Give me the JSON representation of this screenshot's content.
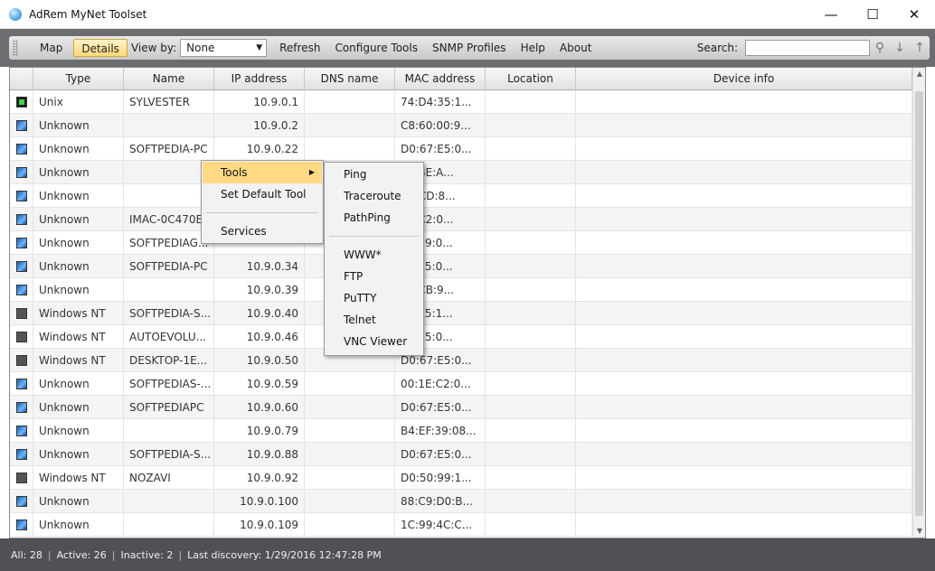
{
  "window": {
    "title": "AdRem MyNet Toolset"
  },
  "toolbar": {
    "map": "Map",
    "details": "Details",
    "view_by_label": "View by:",
    "view_by_value": "None",
    "refresh": "Refresh",
    "configure_tools": "Configure Tools",
    "snmp_profiles": "SNMP Profiles",
    "help": "Help",
    "about": "About",
    "search_label": "Search:",
    "search_value": ""
  },
  "columns": {
    "type": "Type",
    "name": "Name",
    "ip": "IP address",
    "dns": "DNS name",
    "mac": "MAC address",
    "location": "Location",
    "info": "Device info"
  },
  "rows": [
    {
      "icon": "unix-icon",
      "type": "Unix",
      "name": "SYLVESTER",
      "ip": "10.9.0.1",
      "mac": "74:D4:35:1..."
    },
    {
      "icon": "unknown-device-icon",
      "type": "Unknown",
      "name": "",
      "ip": "10.9.0.2",
      "mac": "C8:60:00:9..."
    },
    {
      "icon": "unknown-device-icon",
      "type": "Unknown",
      "name": "SOFTPEDIA-PC",
      "ip": "10.9.0.22",
      "mac": "D0:67:E5:0..."
    },
    {
      "icon": "unknown-device-icon",
      "type": "Unknown",
      "name": "",
      "ip": "",
      "mac": "22:BE:A..."
    },
    {
      "icon": "unknown-device-icon",
      "type": "Unknown",
      "name": "",
      "ip": "",
      "mac": "EB:CD:8..."
    },
    {
      "icon": "unknown-device-icon",
      "type": "Unknown",
      "name": "IMAC-0C470E",
      "ip": "",
      "mac": "1E:C2:0..."
    },
    {
      "icon": "unknown-device-icon",
      "type": "Unknown",
      "name": "SOFTPEDIAG...",
      "ip": "",
      "mac": "50:99:0..."
    },
    {
      "icon": "unknown-device-icon",
      "type": "Unknown",
      "name": "SOFTPEDIA-PC",
      "ip": "10.9.0.34",
      "mac": "67:E5:0..."
    },
    {
      "icon": "unknown-device-icon",
      "type": "Unknown",
      "name": "",
      "ip": "10.9.0.39",
      "mac": "16:CB:9..."
    },
    {
      "icon": "windows-nt-icon",
      "type": "Windows NT",
      "name": "SOFTPEDIA-S...",
      "ip": "10.9.0.40",
      "mac": "67:E5:1..."
    },
    {
      "icon": "windows-nt-icon",
      "type": "Windows NT",
      "name": "AUTOEVOLU...",
      "ip": "10.9.0.46",
      "mac": "67:E5:0..."
    },
    {
      "icon": "windows-nt-icon",
      "type": "Windows NT",
      "name": "DESKTOP-1E...",
      "ip": "10.9.0.50",
      "mac": "D0:67:E5:0..."
    },
    {
      "icon": "unknown-device-icon",
      "type": "Unknown",
      "name": "SOFTPEDIAS-...",
      "ip": "10.9.0.59",
      "mac": "00:1E:C2:0..."
    },
    {
      "icon": "unknown-device-icon",
      "type": "Unknown",
      "name": "SOFTPEDIAPC",
      "ip": "10.9.0.60",
      "mac": "D0:67:E5:0..."
    },
    {
      "icon": "unknown-device-icon",
      "type": "Unknown",
      "name": "",
      "ip": "10.9.0.79",
      "mac": "B4:EF:39:08..."
    },
    {
      "icon": "unknown-device-icon",
      "type": "Unknown",
      "name": "SOFTPEDIA-S...",
      "ip": "10.9.0.88",
      "mac": "D0:67:E5:0..."
    },
    {
      "icon": "windows-nt-icon",
      "type": "Windows NT",
      "name": "NOZAVI",
      "ip": "10.9.0.92",
      "mac": "D0:50:99:1..."
    },
    {
      "icon": "unknown-device-icon",
      "type": "Unknown",
      "name": "",
      "ip": "10.9.0.100",
      "mac": "88:C9:D0:B..."
    },
    {
      "icon": "unknown-device-icon",
      "type": "Unknown",
      "name": "",
      "ip": "10.9.0.109",
      "mac": "1C:99:4C:C..."
    }
  ],
  "context_menu": {
    "tools": "Tools",
    "set_default_tool": "Set Default Tool",
    "services": "Services"
  },
  "tools_submenu": {
    "ping": "Ping",
    "traceroute": "Traceroute",
    "pathping": "PathPing",
    "www": "WWW*",
    "ftp": "FTP",
    "putty": "PuTTY",
    "telnet": "Telnet",
    "vnc_viewer": "VNC Viewer"
  },
  "status": {
    "all": "All: 28",
    "active": "Active: 26",
    "inactive": "Inactive: 2",
    "last_discovery": "Last discovery: 1/29/2016 12:47:28 PM"
  }
}
